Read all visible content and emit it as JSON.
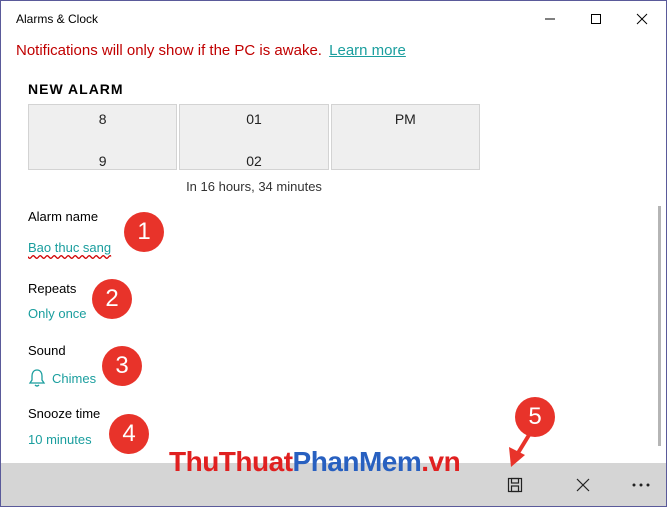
{
  "window": {
    "title": "Alarms & Clock"
  },
  "notice": {
    "text": "Notifications will only show if the PC is awake.",
    "link": "Learn more"
  },
  "alarm": {
    "heading": "NEW ALARM",
    "picker": {
      "hour": [
        "8",
        "9"
      ],
      "minute": [
        "01",
        "02"
      ],
      "period": "PM"
    },
    "remaining": "In 16 hours, 34 minutes",
    "name_label": "Alarm name",
    "name_value": "Bao thuc sang",
    "repeats_label": "Repeats",
    "repeats_value": "Only once",
    "sound_label": "Sound",
    "sound_value": "Chimes",
    "snooze_label": "Snooze time",
    "snooze_value": "10 minutes"
  },
  "badges": [
    "1",
    "2",
    "3",
    "4",
    "5"
  ],
  "watermark": {
    "part1": "ThuThuat",
    "part2": "PhanMem",
    "part3": ".vn"
  },
  "colors": {
    "accent": "#1a9e9e",
    "warning": "#c00000",
    "badge": "#e8332a"
  },
  "icons": {
    "sound": "bell-icon",
    "save": "save-icon",
    "delete": "close-icon",
    "more": "more-icon"
  }
}
